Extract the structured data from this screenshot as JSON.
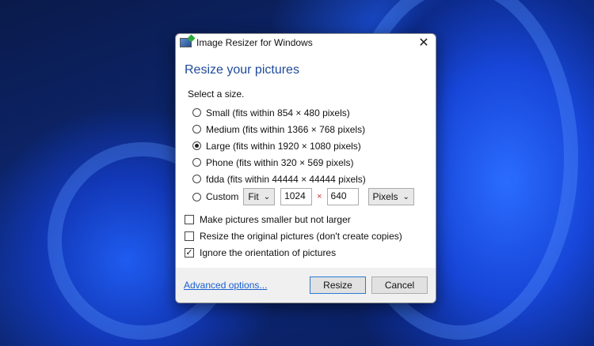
{
  "window": {
    "title": "Image Resizer for Windows",
    "close": "✕"
  },
  "heading": "Resize your pictures",
  "select_label": "Select a size.",
  "sizes": [
    {
      "label": "Small (fits within 854 × 480 pixels)",
      "selected": false
    },
    {
      "label": "Medium (fits within 1366 × 768 pixels)",
      "selected": false
    },
    {
      "label": "Large (fits within 1920 × 1080 pixels)",
      "selected": true
    },
    {
      "label": "Phone (fits within 320 × 569 pixels)",
      "selected": false
    },
    {
      "label": "fdda (fits within 44444 × 44444 pixels)",
      "selected": false
    }
  ],
  "custom": {
    "label": "Custom",
    "fit": "Fit",
    "width": "1024",
    "times": "×",
    "height": "640",
    "unit": "Pixels",
    "chevron": "⌄"
  },
  "checks": [
    {
      "label": "Make pictures smaller but not larger",
      "checked": false
    },
    {
      "label": "Resize the original pictures (don't create copies)",
      "checked": false
    },
    {
      "label": "Ignore the orientation of pictures",
      "checked": true
    }
  ],
  "check_mark": "✓",
  "footer": {
    "advanced": "Advanced options...",
    "resize": "Resize",
    "cancel": "Cancel"
  }
}
